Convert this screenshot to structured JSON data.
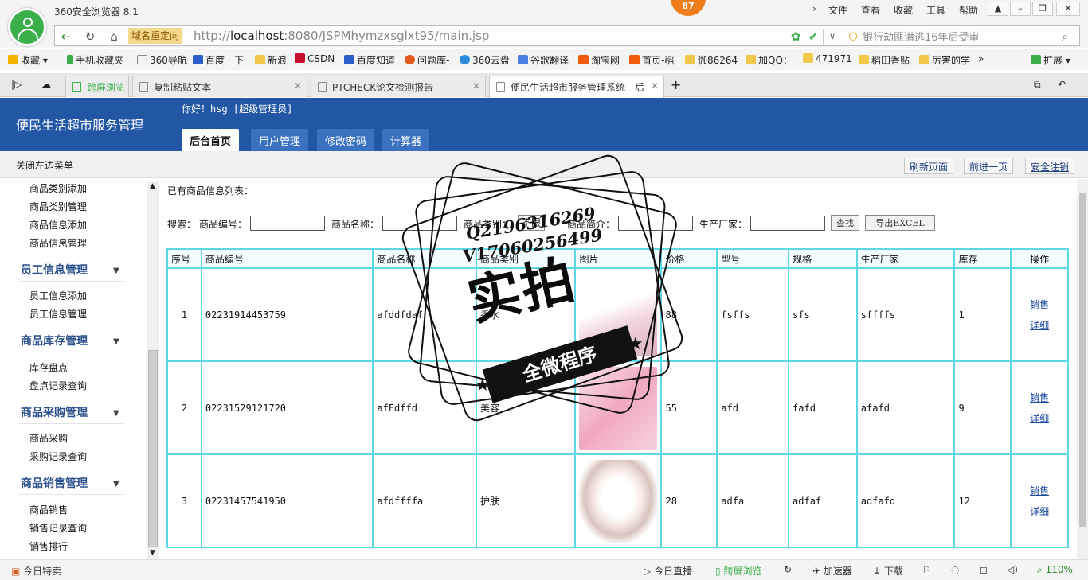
{
  "browser": {
    "title": "360安全浏览器 8.1",
    "badge": "87",
    "menu": [
      "文件",
      "查看",
      "收藏",
      "工具",
      "帮助"
    ],
    "redirect_tag": "域名重定向",
    "url_prefix": "http://",
    "url_host": "localhost",
    "url_rest": ":8080/JSPMhymzxsglxt95/main.jsp",
    "search_placeholder": "银行劫匪潜逃16年后受审",
    "bookmarks": [
      "收藏",
      "手机收藏夹",
      "360导航",
      "百度一下",
      "新浪",
      "CSDN",
      "百度知道",
      "问题库-",
      "360云盘",
      "谷歌翻译",
      "淘宝网",
      "首页-稻",
      "伽86264",
      "加QQ：",
      "471971",
      "稻田香贴",
      "厉害的学"
    ],
    "extensions": "扩展",
    "tabs": [
      {
        "label": "跨屏浏览"
      },
      {
        "label": "复制粘贴文本"
      },
      {
        "label": "PTCHECK论文检测报告"
      },
      {
        "label": "便民生活超市服务管理系统 - 后"
      }
    ]
  },
  "app": {
    "name": "便民生活超市服务管理",
    "greeting": "你好！hsg [超级管理员]",
    "nav": [
      "后台首页",
      "用户管理",
      "修改密码",
      "计算器"
    ],
    "close_menu": "关闭左边菜单",
    "actions": {
      "refresh": "刷新页面",
      "forward": "前进一页",
      "logout": "安全注销"
    }
  },
  "sidebar": {
    "top_items": [
      "商品类别添加",
      "商品类别管理",
      "商品信息添加",
      "商品信息管理"
    ],
    "groups": [
      {
        "title": "员工信息管理",
        "items": [
          "员工信息添加",
          "员工信息管理"
        ]
      },
      {
        "title": "商品库存管理",
        "items": [
          "库存盘点",
          "盘点记录查询"
        ]
      },
      {
        "title": "商品采购管理",
        "items": [
          "商品采购",
          "采购记录查询"
        ]
      },
      {
        "title": "商品销售管理",
        "items": [
          "商品销售",
          "销售记录查询",
          "销售排行"
        ]
      }
    ]
  },
  "list": {
    "title": "已有商品信息列表：",
    "search": {
      "prefix": "搜索：",
      "code_label": "商品编号：",
      "name_label": "商品名称：",
      "category_label": "商品类别：",
      "category_value": "不限",
      "intro_label": "商品简介：",
      "maker_label": "生产厂家：",
      "search_btn": "查找",
      "export_btn": "导出EXCEL"
    },
    "columns": [
      "序号",
      "商品编号",
      "商品名称",
      "商品类别",
      "图片",
      "价格",
      "型号",
      "规格",
      "生产厂家",
      "库存",
      "操作"
    ],
    "rows": [
      {
        "no": "1",
        "code": "02231914453759",
        "name": "afddfdaf",
        "category": "香水",
        "price": "88",
        "model": "fsffs",
        "spec": "sfs",
        "maker": "sffffs",
        "stock": "1"
      },
      {
        "no": "2",
        "code": "02231529121720",
        "name": "afFdffd",
        "category": "美容",
        "price": "55",
        "model": "afd",
        "spec": "fafd",
        "maker": "afafd",
        "stock": "9"
      },
      {
        "no": "3",
        "code": "02231457541950",
        "name": "afdffffa",
        "category": "护肤",
        "price": "28",
        "model": "adfa",
        "spec": "adfaf",
        "maker": "adfafd",
        "stock": "12"
      }
    ],
    "op_sell": "销售",
    "op_detail": "详细"
  },
  "watermark": {
    "line1": "Q2196316269",
    "line2": "V17060256499",
    "big": "实拍",
    "band": "全微程序"
  },
  "statusbar": [
    "今日特卖",
    "今日直播",
    "跨屏浏览",
    "加速器",
    "下载",
    "110%"
  ],
  "colors": {
    "header": "#2257a6",
    "table_border": "#5dd8e4",
    "link": "#1b4a9e",
    "green": "#3bb04a"
  }
}
